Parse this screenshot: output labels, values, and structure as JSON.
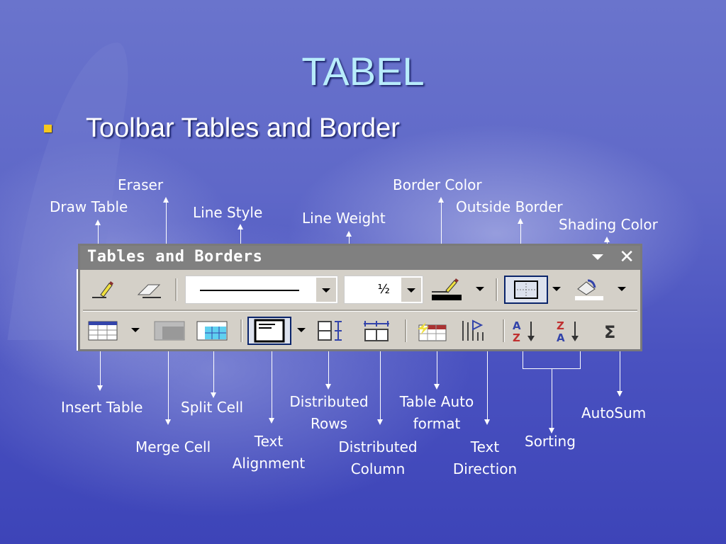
{
  "slide": {
    "title": "TABEL",
    "bullet": "Toolbar Tables and Border"
  },
  "toolbar": {
    "title": "Tables and Borders",
    "close_label": "✕",
    "line_weight_value": "½",
    "row1": [
      "draw-table",
      "eraser",
      "line-style",
      "line-weight",
      "border-color",
      "outside-border",
      "shading-color"
    ],
    "row2": [
      "insert-table",
      "merge-cells",
      "split-cells",
      "text-alignment",
      "distribute-rows",
      "distribute-columns",
      "table-autoformat",
      "text-direction",
      "sort-ascending",
      "sort-descending",
      "autosum"
    ]
  },
  "callouts": {
    "draw_table": "Draw Table",
    "eraser": "Eraser",
    "line_style": "Line Style",
    "line_weight": "Line Weight",
    "border_color": "Border Color",
    "outside_border": "Outside Border",
    "shading_color": "Shading Color",
    "insert_table": "Insert Table",
    "merge_cell": "Merge Cell",
    "split_cell": "Split Cell",
    "text_alignment_1": "Text",
    "text_alignment_2": "Alignment",
    "distributed_rows_1": "Distributed",
    "distributed_rows_2": "Rows",
    "distributed_column_1": "Distributed",
    "distributed_column_2": "Column",
    "table_autoformat_1": "Table Auto",
    "table_autoformat_2": "format",
    "text_direction_1": "Text",
    "text_direction_2": "Direction",
    "sorting": "Sorting",
    "autosum": "AutoSum"
  },
  "colors": {
    "bullet": "#f7c81d",
    "title": "#b8ecfb",
    "toolbar_bg": "#d4d0c8",
    "toolbar_title_bg": "#808080",
    "pressed_border": "#0a246a"
  }
}
